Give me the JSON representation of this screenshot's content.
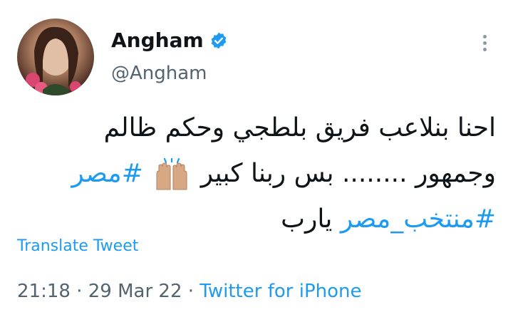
{
  "user": {
    "display_name": "Angham",
    "handle": "@Angham",
    "verified": true,
    "avatar": "profile-photo"
  },
  "tweet": {
    "line1": "احنا بنلاعب فريق بلطجي وحكم ظالم",
    "line2_text": "وجمهور ........ بس ربنا كبير",
    "line2_emoji": "raising-hands-emoji",
    "hashtag1": "#مصر",
    "hashtag2": "#منتخب_مصر",
    "line3_text": "يارب"
  },
  "actions": {
    "translate": "Translate Tweet"
  },
  "meta": {
    "time": "21:18",
    "separator": " · ",
    "date": "29 Mar 22",
    "source": "Twitter for iPhone"
  },
  "colors": {
    "accent": "#1d9bf0",
    "text": "#0f1419",
    "secondary": "#536471"
  }
}
